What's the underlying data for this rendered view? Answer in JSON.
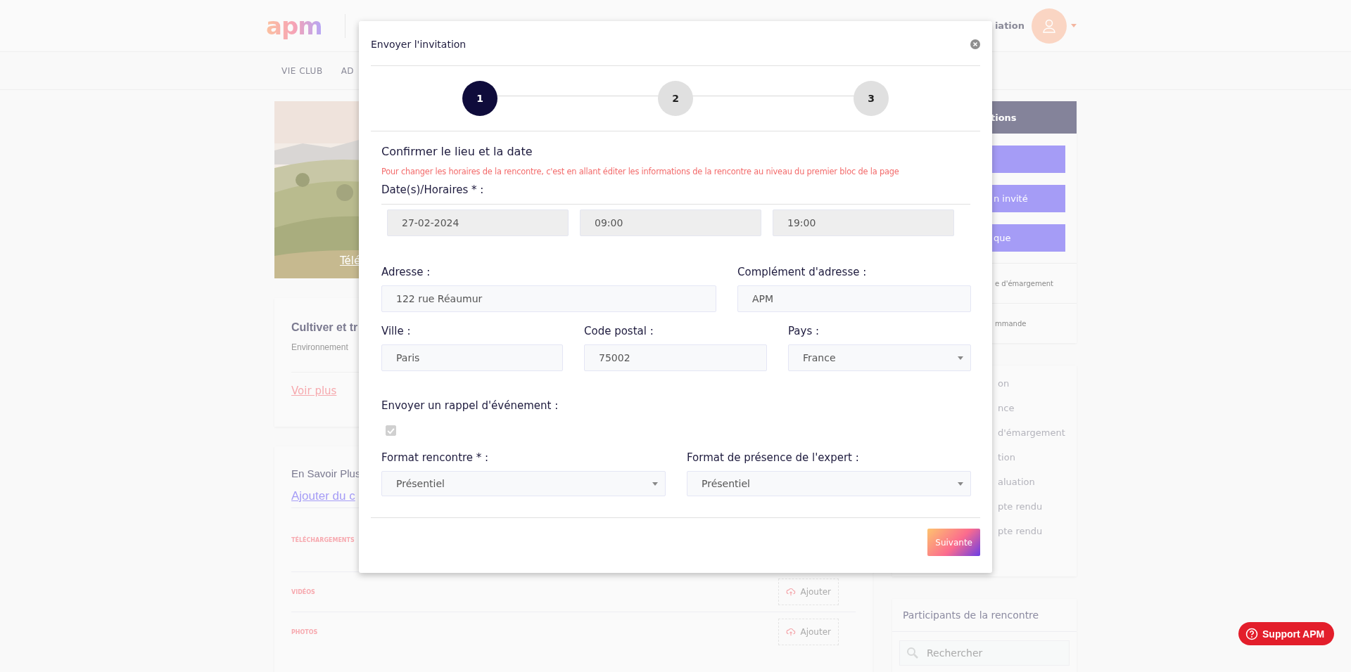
{
  "header": {
    "logo": "apm",
    "menu_text": "iation"
  },
  "nav": [
    "VIE CLUB",
    "AD"
  ],
  "left": {
    "image": {
      "kind": "picture",
      "caption": "Télé"
    },
    "intro_card": {
      "title": "Cultiver et tr",
      "subtitle": "Environnement",
      "link": "Voir plus"
    },
    "more_card": {
      "title": "En Savoir Plus",
      "link": "Ajouter du c",
      "sections": [
        {
          "label": "TÉLÉCHARGEMENTS"
        },
        {
          "label": "VIDÉOS",
          "button": "Ajouter"
        },
        {
          "label": "PHOTOS",
          "button": "Ajouter"
        }
      ]
    }
  },
  "right": {
    "actions": {
      "title": "tions",
      "buttons": [
        {
          "kind": "blank"
        },
        {
          "kind": "text",
          "label": "n invité"
        },
        {
          "kind": "text",
          "label": "que"
        }
      ],
      "links": [
        "e d'émargement",
        "mmande"
      ]
    },
    "menu": [
      "on",
      "nce",
      "d'émargement",
      "tion",
      "aluation",
      "pte rendu",
      "pte rendu"
    ],
    "participants": {
      "title": "Participants de la rencontre",
      "search": {
        "placeholder": "Rechercher"
      }
    }
  },
  "modal": {
    "title": "Envoyer l'invitation",
    "steps": [
      {
        "label": "1",
        "selected": true
      },
      {
        "label": "2",
        "selected": false
      },
      {
        "label": "3",
        "selected": false
      }
    ],
    "section_title": "Confirmer le lieu et la date",
    "note": "Pour changer les horaires de la rencontre, c'est en allant éditer les informations de la rencontre au niveau du premier bloc de la page",
    "schedule": {
      "label": "Date(s)/Horaires * :",
      "fields": [
        "27-02-2024",
        "09:00",
        "19:00"
      ]
    },
    "street_fields": [
      {
        "label": "Adresse :",
        "value": "122 rue Réaumur",
        "kind": "input"
      },
      {
        "label": "Complément d'adresse :",
        "value": "APM",
        "kind": "input"
      }
    ],
    "city_fields": [
      {
        "label": "Ville :",
        "value": "Paris",
        "kind": "input"
      },
      {
        "label": "Code postal :",
        "value": "75002",
        "kind": "input"
      },
      {
        "label": "Pays :",
        "value": "France",
        "kind": "select"
      }
    ],
    "reminder": {
      "label": "Envoyer un rappel d'événement :",
      "checked": true,
      "disabled": true
    },
    "formats": [
      {
        "label": "Format rencontre * :",
        "value": "Présentiel"
      },
      {
        "label": "Format de présence de l'expert :",
        "value": "Présentiel"
      }
    ],
    "next_button": "Suivante"
  },
  "support_button": "Support APM"
}
